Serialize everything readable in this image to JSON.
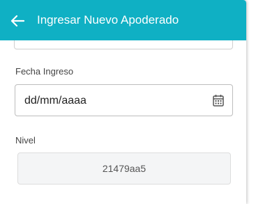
{
  "header": {
    "title": "Ingresar Nuevo Apoderado",
    "back_icon": "arrow-left-icon",
    "background": "#0fb0c4"
  },
  "form": {
    "fecha_ingreso": {
      "label": "Fecha Ingreso",
      "value": "dd/mm/aaaa",
      "icon": "calendar-icon"
    },
    "nivel": {
      "label": "Nivel",
      "value": "21479aa5"
    }
  }
}
